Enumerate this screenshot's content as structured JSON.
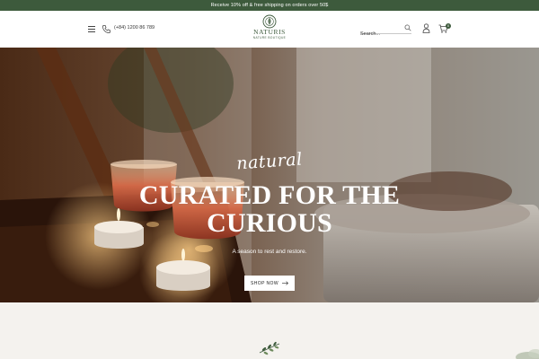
{
  "promo": {
    "text": "Receive 10% off & free shipping on orders over 50$"
  },
  "header": {
    "menu_icon": "hamburger-menu-icon",
    "phone_icon": "phone-icon",
    "phone": "(+84) 1200 86 789",
    "logo": {
      "name": "NATURIS",
      "tagline": "NATURE BOUTIQUE"
    },
    "search": {
      "placeholder": "Search...",
      "value": "",
      "icon": "search-icon"
    },
    "account_icon": "user-icon",
    "cart_icon": "cart-icon",
    "cart_count": "0"
  },
  "hero": {
    "script_text": "natural",
    "title_line1": "CURATED FOR THE",
    "title_line2": "CURIOUS",
    "subtitle": "A season to rest and restore.",
    "button_label": "SHOP NOW",
    "button_icon": "arrow-right-icon"
  },
  "below": {
    "ornament_icon": "sprig-icon"
  },
  "colors": {
    "brand_green": "#3d5a3c",
    "background": "#f4f2ee",
    "white": "#ffffff"
  }
}
